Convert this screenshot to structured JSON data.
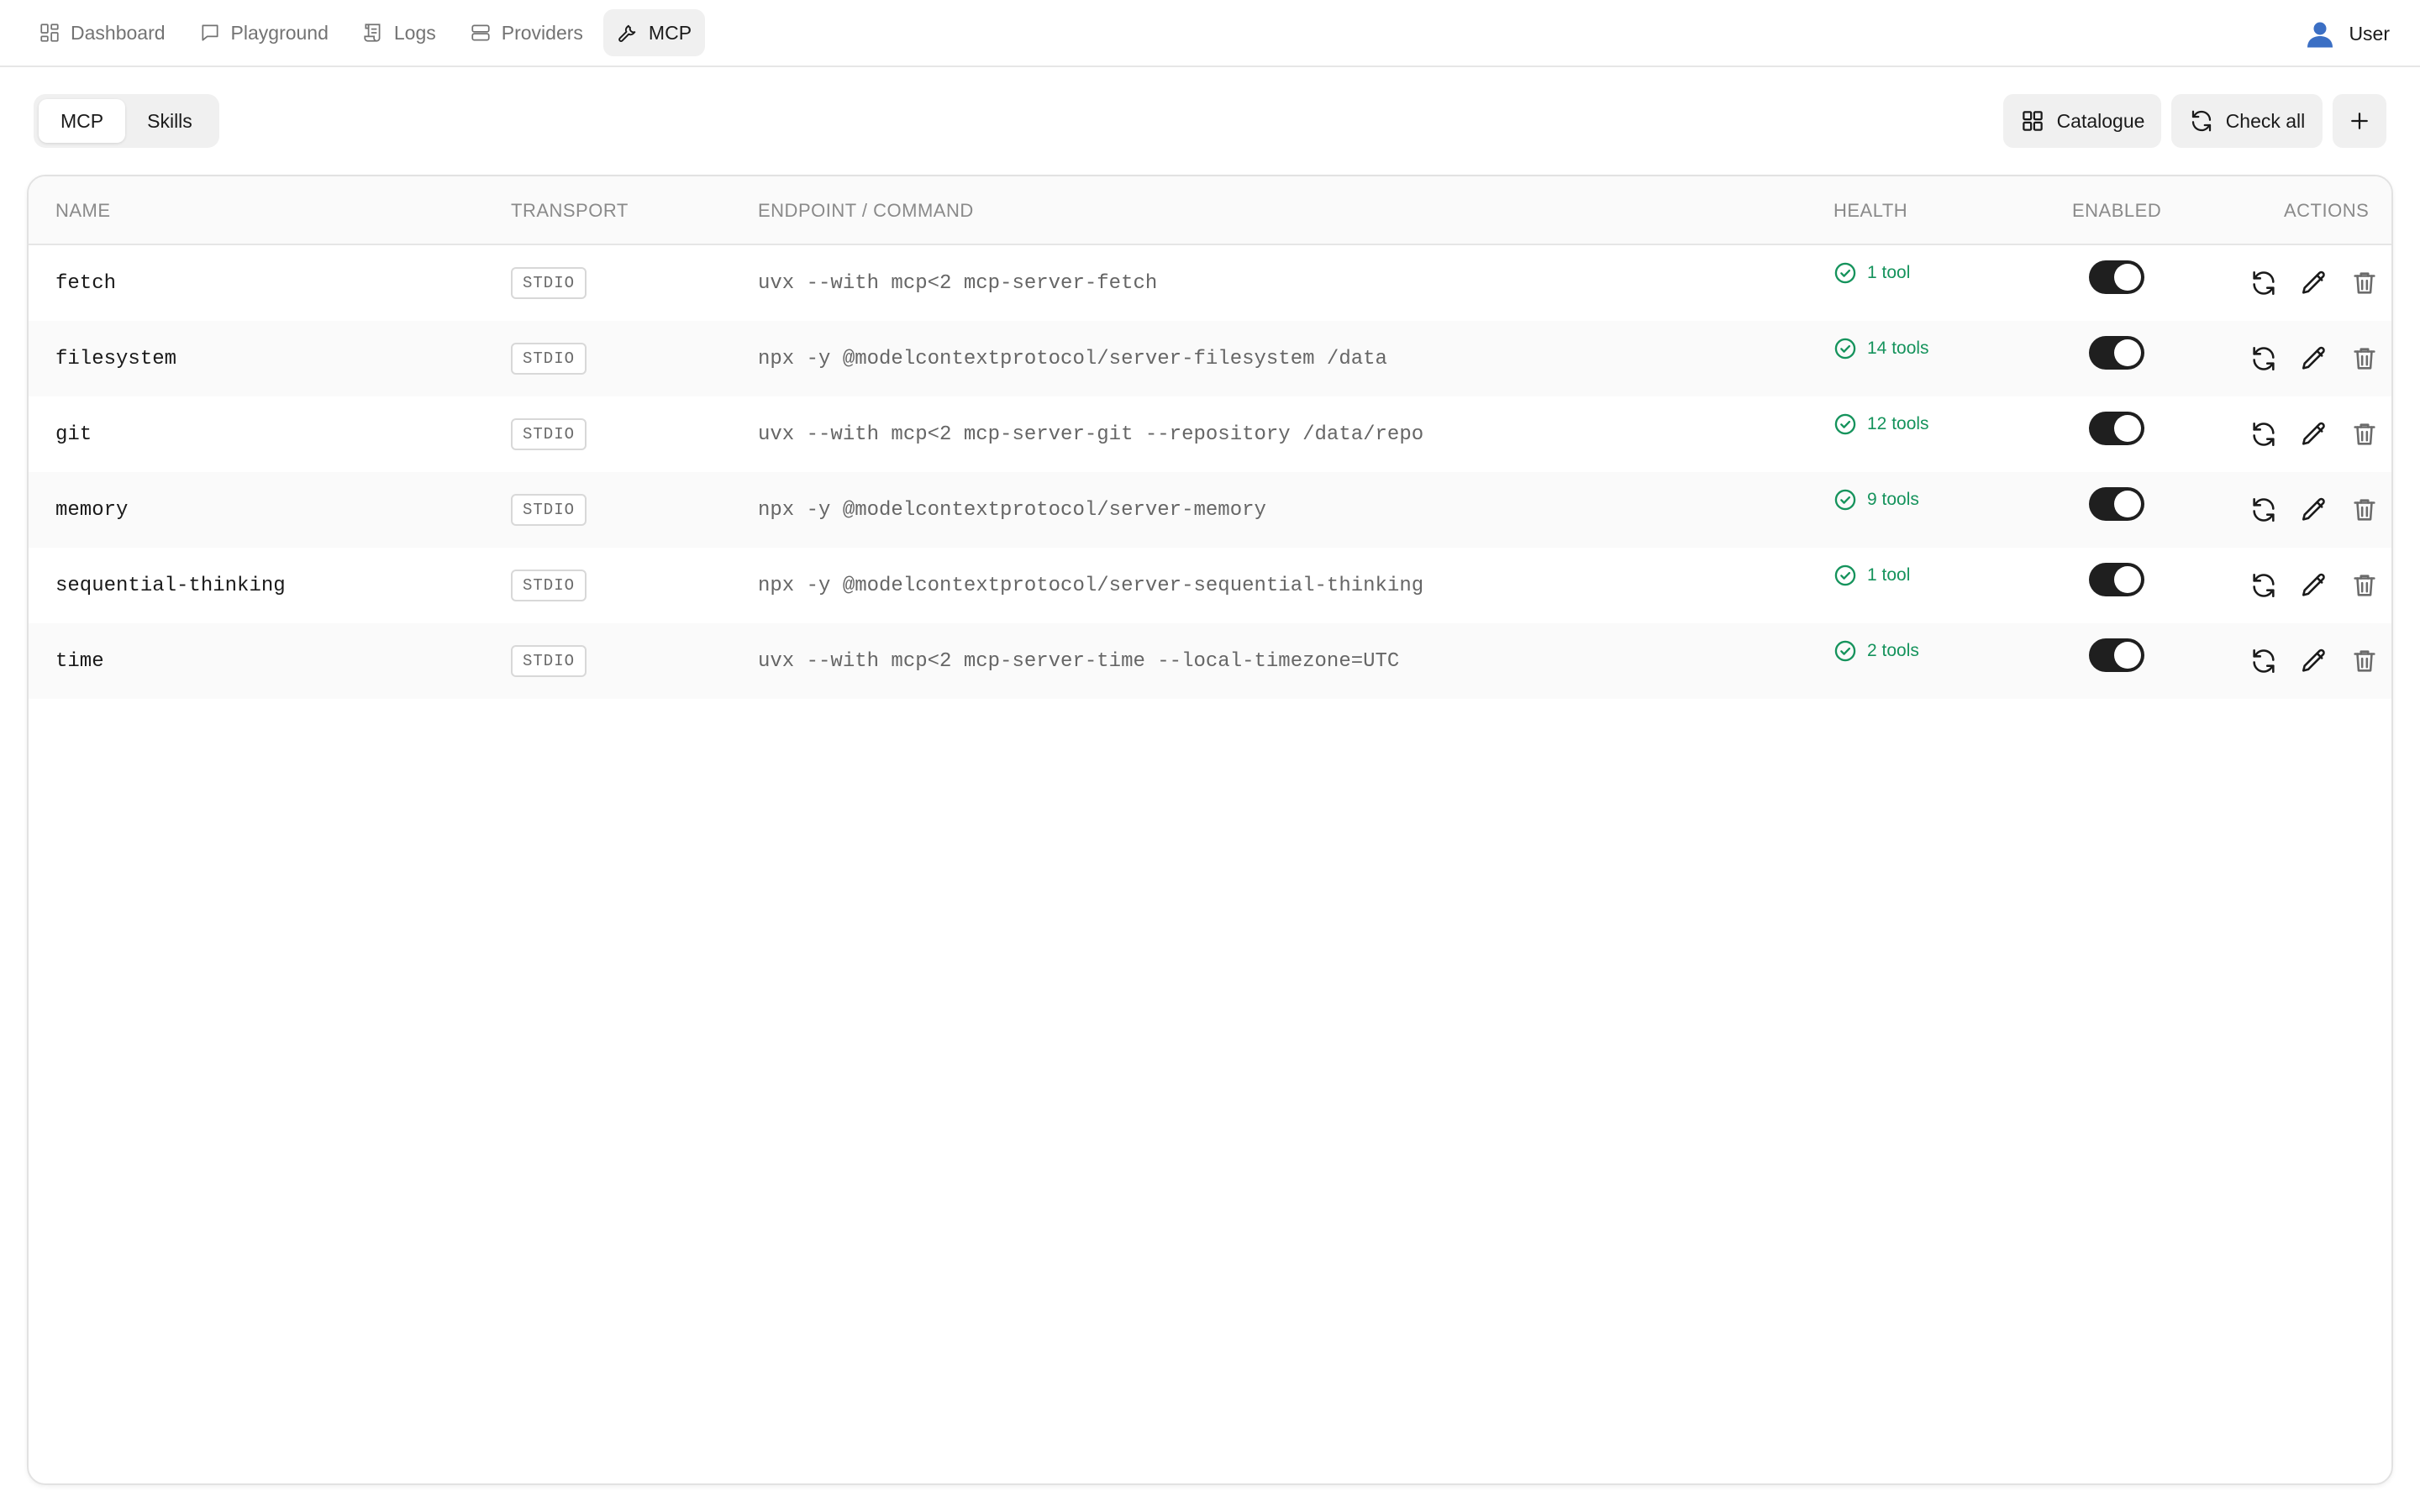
{
  "nav": {
    "items": [
      {
        "label": "Dashboard",
        "icon": "grid-icon"
      },
      {
        "label": "Playground",
        "icon": "chat-icon"
      },
      {
        "label": "Logs",
        "icon": "scroll-icon"
      },
      {
        "label": "Providers",
        "icon": "server-icon"
      },
      {
        "label": "MCP",
        "icon": "wrench-icon",
        "active": true
      }
    ],
    "user_label": "User"
  },
  "toolbar": {
    "segments": [
      "MCP",
      "Skills"
    ],
    "active_segment": "MCP",
    "catalogue_label": "Catalogue",
    "check_all_label": "Check all",
    "add_icon": "plus-icon"
  },
  "table": {
    "headers": {
      "name": "NAME",
      "transport": "TRANSPORT",
      "endpoint": "ENDPOINT / COMMAND",
      "health": "HEALTH",
      "enabled": "ENABLED",
      "actions": "ACTIONS"
    },
    "rows": [
      {
        "name": "fetch",
        "transport": "STDIO",
        "endpoint": "uvx --with mcp<2 mcp-server-fetch",
        "health": "1 tool",
        "enabled": true
      },
      {
        "name": "filesystem",
        "transport": "STDIO",
        "endpoint": "npx -y @modelcontextprotocol/server-filesystem /data",
        "health": "14 tools",
        "enabled": true
      },
      {
        "name": "git",
        "transport": "STDIO",
        "endpoint": "uvx --with mcp<2 mcp-server-git --repository /data/repo",
        "health": "12 tools",
        "enabled": true
      },
      {
        "name": "memory",
        "transport": "STDIO",
        "endpoint": "npx -y @modelcontextprotocol/server-memory",
        "health": "9 tools",
        "enabled": true
      },
      {
        "name": "sequential-thinking",
        "transport": "STDIO",
        "endpoint": "npx -y @modelcontextprotocol/server-sequential-thinking",
        "health": "1 tool",
        "enabled": true
      },
      {
        "name": "time",
        "transport": "STDIO",
        "endpoint": "uvx --with mcp<2 mcp-server-time --local-timezone=UTC",
        "health": "2 tools",
        "enabled": true
      }
    ]
  },
  "colors": {
    "health_ok": "#15935c",
    "toggle_on": "#1f1f1f",
    "active_tab_bg": "#f0f0f0"
  }
}
